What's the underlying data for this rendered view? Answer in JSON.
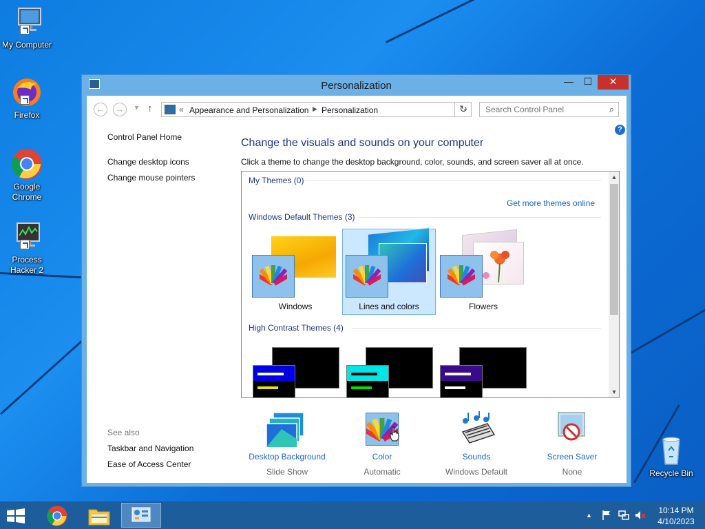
{
  "desktop": {
    "icons": [
      {
        "label": "My Computer"
      },
      {
        "label": "Firefox"
      },
      {
        "label": "Google Chrome"
      },
      {
        "label": "Process Hacker 2"
      },
      {
        "label": "Recycle Bin"
      }
    ]
  },
  "window": {
    "title": "Personalization",
    "controls": {
      "minimize": "—",
      "maximize": "☐",
      "close": "✕"
    },
    "address": {
      "separator": "«",
      "crumbs": [
        "Appearance and Personalization",
        "Personalization"
      ]
    },
    "search_placeholder": "Search Control Panel",
    "help": "?"
  },
  "leftnav": {
    "links": [
      "Control Panel Home",
      "Change desktop icons",
      "Change mouse pointers"
    ],
    "see_also_title": "See also",
    "see_also": [
      "Taskbar and Navigation",
      "Ease of Access Center"
    ]
  },
  "main": {
    "heading": "Change the visuals and sounds on your computer",
    "subtext": "Click a theme to change the desktop background, color, sounds, and screen saver all at once.",
    "groups": {
      "my_themes": "My Themes (0)",
      "get_more": "Get more themes online",
      "default_themes": "Windows Default Themes (3)",
      "high_contrast": "High Contrast Themes (4)"
    },
    "default_themes": [
      {
        "name": "Windows",
        "selected": false
      },
      {
        "name": "Lines and colors",
        "selected": true
      },
      {
        "name": "Flowers",
        "selected": false
      }
    ]
  },
  "options": [
    {
      "label": "Desktop Background",
      "value": "Slide Show"
    },
    {
      "label": "Color",
      "value": "Automatic"
    },
    {
      "label": "Sounds",
      "value": "Windows Default"
    },
    {
      "label": "Screen Saver",
      "value": "None"
    }
  ],
  "taskbar": {
    "time": "10:14 PM",
    "date": "4/10/2023"
  },
  "colors": {
    "accent_link": "#1a66c7",
    "heading": "#1e3287",
    "close_button": "#c7312b",
    "selection": "#cce8ff"
  }
}
